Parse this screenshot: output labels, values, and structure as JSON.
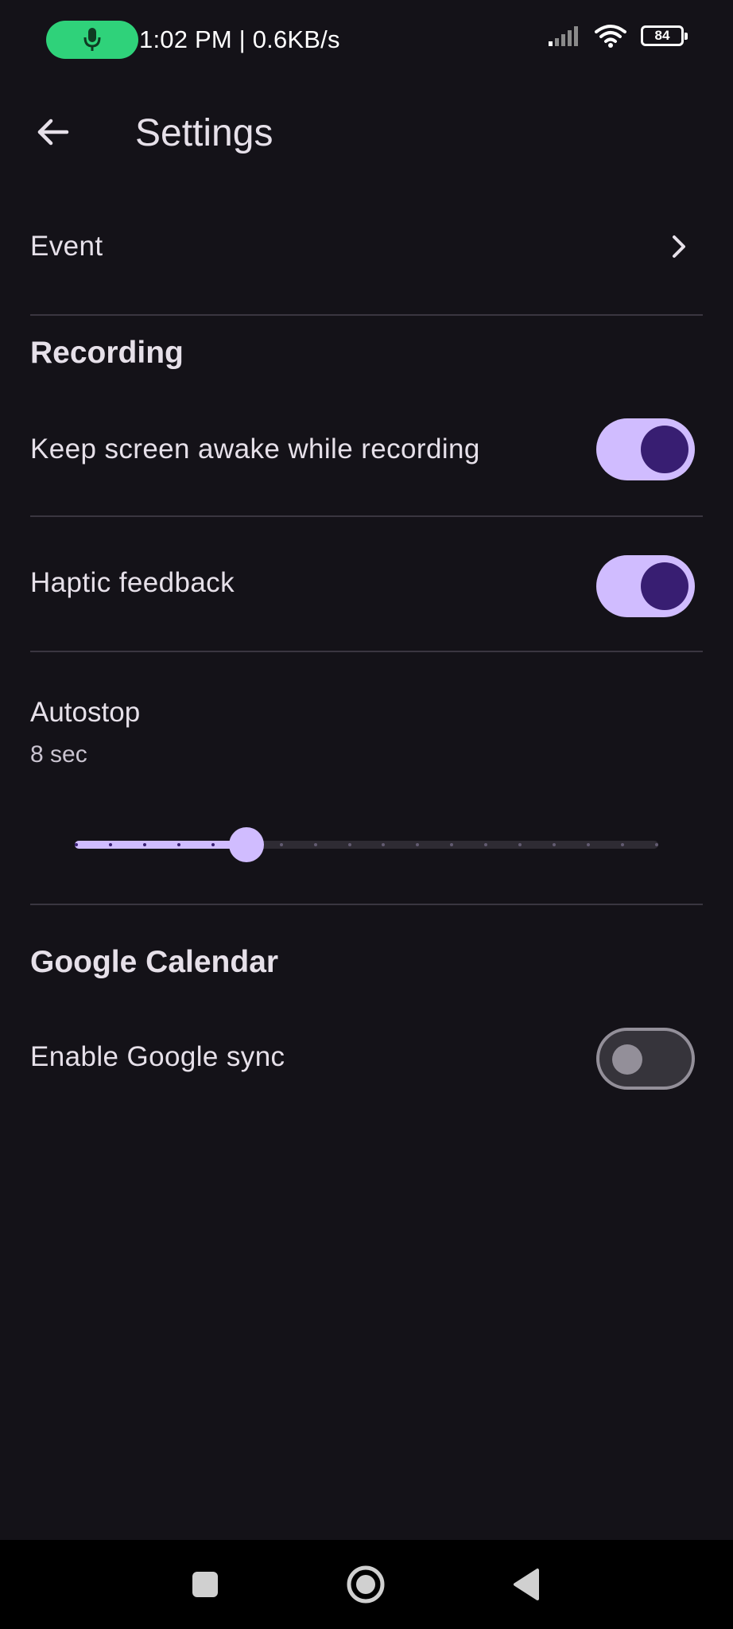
{
  "status_bar": {
    "time_speed": "1:02 PM | 0.6KB/s",
    "battery_level": "84",
    "mic_indicator_color": "#2fd27a",
    "icons": [
      "mic-icon",
      "signal-icon",
      "wifi-icon",
      "battery-icon"
    ]
  },
  "app_bar": {
    "title": "Settings"
  },
  "event_row": {
    "label": "Event"
  },
  "recording": {
    "header": "Recording",
    "keep_awake_label": "Keep screen awake while recording",
    "keep_awake_on": true,
    "haptic_label": "Haptic feedback",
    "haptic_on": true
  },
  "autostop": {
    "title": "Autostop",
    "value_text": "8 sec",
    "slider_fraction": 0.294,
    "slider_steps": 17
  },
  "google_calendar": {
    "header": "Google Calendar",
    "sync_label": "Enable Google sync",
    "sync_on": false
  },
  "colors": {
    "background": "#141218",
    "accent": "#d0bcff",
    "accent_dark": "#381e72",
    "divider": "#3a3640"
  },
  "nav_bar": {
    "icons": [
      "recents-square-icon",
      "home-circle-icon",
      "back-triangle-icon"
    ]
  }
}
